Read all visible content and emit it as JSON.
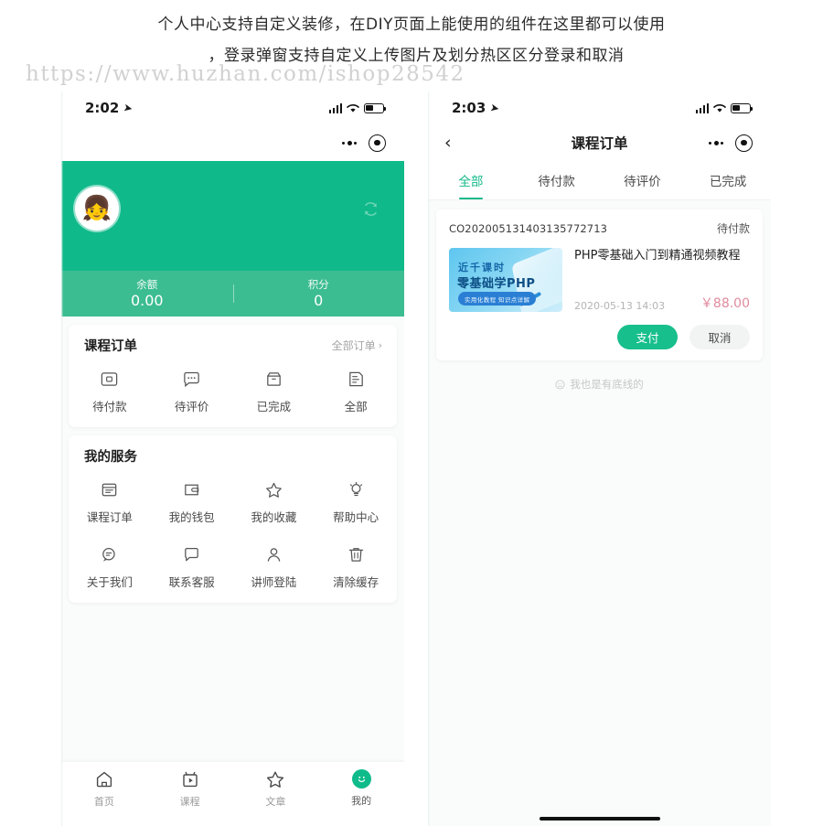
{
  "caption": {
    "line1": "个人中心支持自定义装修，在DIY页面上能使用的组件在这里都可以使用",
    "line2": "，登录弹窗支持自定义上传图片及划分热区区分登录和取消",
    "watermark": "https://www.huzhan.com/ishop28542"
  },
  "colors": {
    "brand_green": "#10b98a",
    "stats_green": "#3cbd91",
    "price_pink": "#e08a9c",
    "page_bg": "#fafbfb"
  },
  "left_phone": {
    "status_bar": {
      "time": "2:02",
      "location_icon": "location-arrow-icon",
      "signal_icon": "signal-bars-icon",
      "wifi_icon": "wifi-icon",
      "battery_icon": "battery-icon"
    },
    "capsule": {
      "menu_icon": "more-dots-icon",
      "target_icon": "target-circle-icon"
    },
    "hero": {
      "avatar_icon": "user-avatar",
      "refresh_icon": "refresh-icon",
      "stats": [
        {
          "label": "余额",
          "value": "0.00"
        },
        {
          "label": "积分",
          "value": "0"
        }
      ]
    },
    "orders_card": {
      "title": "课程订单",
      "more_label": "全部订单",
      "more_icon": "chevron-right-icon",
      "items": [
        {
          "label": "待付款",
          "icon": "wallet-pay-icon"
        },
        {
          "label": "待评价",
          "icon": "comment-icon"
        },
        {
          "label": "已完成",
          "icon": "box-icon"
        },
        {
          "label": "全部",
          "icon": "list-all-icon"
        }
      ]
    },
    "services_card": {
      "title": "我的服务",
      "items": [
        {
          "label": "课程订单",
          "icon": "notebook-icon"
        },
        {
          "label": "我的钱包",
          "icon": "wallet-icon"
        },
        {
          "label": "我的收藏",
          "icon": "star-icon"
        },
        {
          "label": "帮助中心",
          "icon": "lightbulb-icon"
        },
        {
          "label": "关于我们",
          "icon": "chat-bubble-icon"
        },
        {
          "label": "联系客服",
          "icon": "message-icon"
        },
        {
          "label": "讲师登陆",
          "icon": "user-icon"
        },
        {
          "label": "清除缓存",
          "icon": "trash-icon"
        }
      ]
    },
    "tabbar": [
      {
        "label": "首页",
        "icon": "home-icon",
        "active": false
      },
      {
        "label": "课程",
        "icon": "video-icon",
        "active": false
      },
      {
        "label": "文章",
        "icon": "star-icon",
        "active": false
      },
      {
        "label": "我的",
        "icon": "smiley-icon",
        "active": true
      }
    ]
  },
  "right_phone": {
    "status_bar": {
      "time": "2:03",
      "location_icon": "location-arrow-icon",
      "signal_icon": "signal-bars-icon",
      "wifi_icon": "wifi-icon",
      "battery_icon": "battery-icon"
    },
    "nav": {
      "back_icon": "chevron-left-icon",
      "title": "课程订单",
      "menu_icon": "more-dots-icon",
      "target_icon": "target-circle-icon"
    },
    "tabs": [
      {
        "label": "全部",
        "active": true
      },
      {
        "label": "待付款",
        "active": false
      },
      {
        "label": "待评价",
        "active": false
      },
      {
        "label": "已完成",
        "active": false
      }
    ],
    "order": {
      "order_no": "CO202005131403135772713",
      "status": "待付款",
      "thumb": {
        "line1": "近千课时",
        "line2": "零基础学PHP",
        "badge": "实用化教程 知识点详解"
      },
      "name": "PHP零基础入门到精通视频教程",
      "date": "2020-05-13 14:03",
      "price": "￥88.00",
      "buttons": [
        {
          "label": "支付",
          "kind": "primary"
        },
        {
          "label": "取消",
          "kind": "secondary"
        }
      ]
    },
    "end_text": "我也是有底线的",
    "end_icon": "smiley-outline-icon"
  }
}
